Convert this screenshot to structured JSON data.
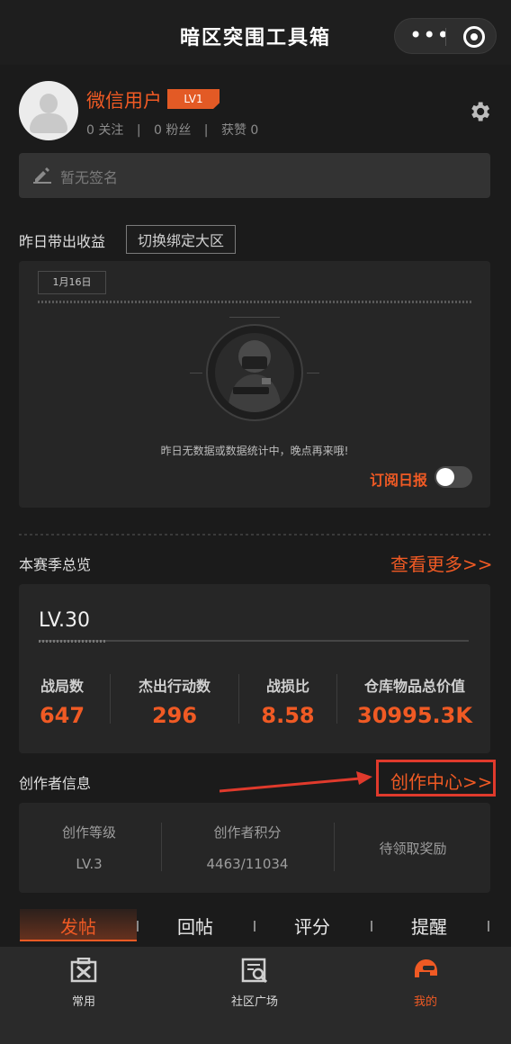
{
  "app": {
    "title": "暗区突围工具箱"
  },
  "profile": {
    "username": "微信用户",
    "level_badge": "LV1",
    "follow": "0 关注",
    "fans": "0 粉丝",
    "likes": "获赞 0",
    "sep": "|",
    "signature_placeholder": "暂无签名"
  },
  "yesterday": {
    "label": "昨日带出收益",
    "switch_region": "切换绑定大区",
    "date": "1月16日",
    "no_data": "昨日无数据或数据统计中，晚点再来哦!",
    "subscribe_label": "订阅日报",
    "subscribe_on": false
  },
  "season": {
    "label": "本赛季总览",
    "see_more": "查看更多>>",
    "level": "LV.30",
    "stats": [
      {
        "label": "战局数",
        "value": "647"
      },
      {
        "label": "杰出行动数",
        "value": "296"
      },
      {
        "label": "战损比",
        "value": "8.58"
      },
      {
        "label": "仓库物品总价值",
        "value": "30995.3K"
      }
    ]
  },
  "creator": {
    "label": "创作者信息",
    "center_link": "创作中心>>",
    "cols": [
      {
        "label": "创作等级",
        "value": "LV.3"
      },
      {
        "label": "创作者积分",
        "value": "4463/11034"
      },
      {
        "label": "待领取奖励",
        "value": ""
      }
    ]
  },
  "post_tabs": [
    "发帖",
    "回帖",
    "评分",
    "提醒"
  ],
  "bottom_nav": [
    {
      "label": "常用",
      "icon": "toolbox-icon"
    },
    {
      "label": "社区广场",
      "icon": "community-icon"
    },
    {
      "label": "我的",
      "icon": "helmet-icon"
    }
  ],
  "colors": {
    "accent": "#f05a24",
    "highlight_box": "#e03a2c",
    "background": "#1b1b1b",
    "card": "#262626"
  }
}
